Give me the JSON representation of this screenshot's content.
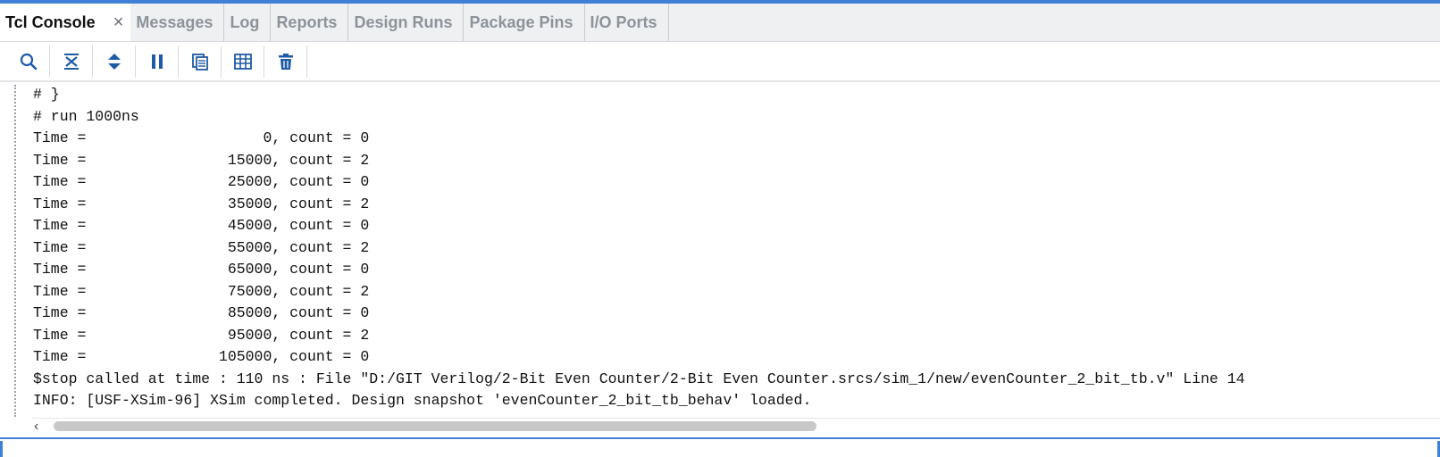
{
  "tabs": [
    {
      "label": "Tcl Console",
      "active": true,
      "close_glyph": "×"
    },
    {
      "label": "Messages"
    },
    {
      "label": "Log"
    },
    {
      "label": "Reports"
    },
    {
      "label": "Design Runs"
    },
    {
      "label": "Package Pins"
    },
    {
      "label": "I/O Ports"
    }
  ],
  "toolbar": {
    "icons": [
      "search-icon",
      "collapse-all-icon",
      "expand-all-icon",
      "pause-icon",
      "copy-icon",
      "columns-icon",
      "delete-icon"
    ]
  },
  "console": {
    "lines": [
      "# }",
      "# run 1000ns",
      "Time =                    0, count = 0",
      "Time =                15000, count = 2",
      "Time =                25000, count = 0",
      "Time =                35000, count = 2",
      "Time =                45000, count = 0",
      "Time =                55000, count = 2",
      "Time =                65000, count = 0",
      "Time =                75000, count = 2",
      "Time =                85000, count = 0",
      "Time =                95000, count = 2",
      "Time =               105000, count = 0",
      "$stop called at time : 110 ns : File \"D:/GIT Verilog/2-Bit Even Counter/2-Bit Even Counter.srcs/sim_1/new/evenCounter_2_bit_tb.v\" Line 14",
      "INFO: [USF-XSim-96] XSim completed. Design snapshot 'evenCounter_2_bit_tb_behav' loaded."
    ]
  },
  "scrollbar": {
    "left_arrow": "‹"
  },
  "colors": {
    "accent": "#3f7fd6",
    "icon": "#1f5aa6"
  }
}
